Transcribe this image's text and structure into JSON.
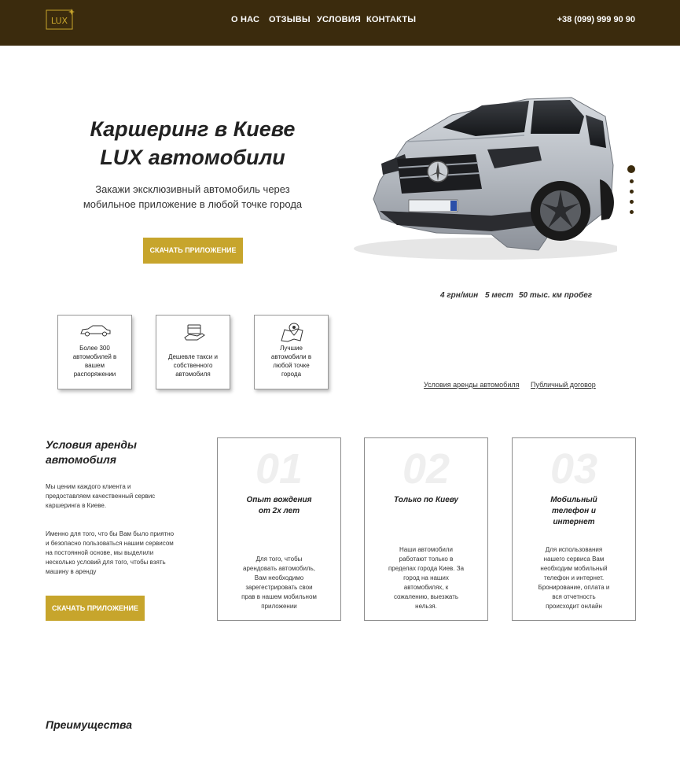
{
  "header": {
    "logo_text": "LUX",
    "nav": [
      "О НАС",
      "ОТЗЫВЫ",
      "УСЛОВИЯ",
      "КОНТАКТЫ"
    ],
    "phone": "+38 (099) 999 90 90"
  },
  "hero": {
    "title_line1": "Каршеринг в Киеве",
    "title_line2": "LUX автомобили",
    "subtitle_line1": "Закажи эксклюзивный автомобиль через",
    "subtitle_line2": "мобильное приложение в любой точке города",
    "button": "СКАЧАТЬ ПРИЛОЖЕНИЕ",
    "slides_count": 5,
    "active_slide": 1
  },
  "specs": [
    "4 грн/мин",
    "5 мест",
    "50 тыс. км пробег"
  ],
  "features": [
    {
      "icon": "car-icon",
      "text": [
        "Более 300",
        "автомобилей в",
        "вашем",
        "распоряжении"
      ]
    },
    {
      "icon": "cash-hand-icon",
      "text": [
        "Дешевле такси и",
        "собственного",
        "автомобиля"
      ]
    },
    {
      "icon": "map-location-icon",
      "text": [
        "Лучшие",
        "автомобили в",
        "любой точке",
        "города"
      ]
    }
  ],
  "links": [
    "Условия аренды автомобиля",
    "Публичный договор"
  ],
  "conditions": {
    "title_line1": "Условия аренды",
    "title_line2": "автомобиля",
    "p1": [
      "Мы ценим каждого клиента и",
      "предоставляем качественный сервис",
      "каршеринга в Киеве."
    ],
    "p2": [
      "Именно для того, что бы Вам было приятно",
      "и безопасно пользоваться нашим сервисом",
      "на постоянной основе, мы выделили",
      "несколько условий для того, чтобы взять",
      "машину в аренду"
    ],
    "button": "СКАЧАТЬ ПРИЛОЖЕНИЕ",
    "cards": [
      {
        "num": "01",
        "title": [
          "Опыт вождения",
          "от 2х лет"
        ],
        "text": [
          "Для того, чтобы",
          "арендовать автомобиль,",
          "Вам необходимо",
          "зарегестрировать свои",
          "прав в нашем мобильном",
          "приложении"
        ]
      },
      {
        "num": "02",
        "title": [
          "Только по Киеву"
        ],
        "text": [
          "Наши автомобили",
          "работают только в",
          "пределах города Киев. За",
          "город на наших",
          "автомобилях, к",
          "сожалению, выезжать",
          "нельзя."
        ]
      },
      {
        "num": "03",
        "title": [
          "Мобильный",
          "телефон и",
          "интернет"
        ],
        "text": [
          "Для использования",
          "нашего сервиса Вам",
          "необходим мобильный",
          "телефон и интернет.",
          "Бронирование, оплата и",
          "вся отчетность",
          "происходит онлайн"
        ]
      }
    ]
  },
  "advantages": {
    "title": "Преимущества"
  },
  "colors": {
    "header_bg": "#3b2b0d",
    "accent_gold": "#c7a52c",
    "text_dark": "#222222"
  }
}
